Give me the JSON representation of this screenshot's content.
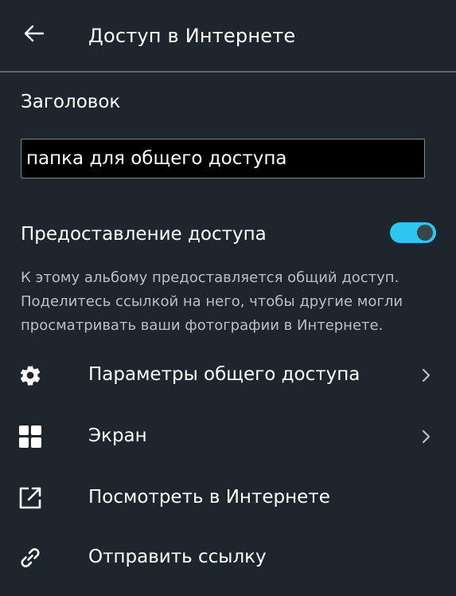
{
  "header": {
    "title": "Доступ в Интернете",
    "back_icon": "arrow-left-icon"
  },
  "title_section": {
    "label": "Заголовок",
    "input_value": "папка для общего доступа"
  },
  "sharing": {
    "label": "Предоставление доступа",
    "enabled": true,
    "description_lines": [
      "К этому альбому предоставляется общий доступ.",
      "Поделитесь ссылкой на него, чтобы другие могли",
      "просматривать ваши фотографии в Интернете."
    ],
    "toggle_color": "#2ec6f1"
  },
  "menu": {
    "items": [
      {
        "label": "Параметры общего доступа",
        "icon": "gear-icon",
        "has_chevron": true
      },
      {
        "label": "Экран",
        "icon": "layout-grid-icon",
        "has_chevron": true
      },
      {
        "label": "Посмотреть в Интернете",
        "icon": "open-external-icon",
        "has_chevron": false
      },
      {
        "label": "Отправить ссылку",
        "icon": "link-icon",
        "has_chevron": false
      }
    ]
  },
  "colors": {
    "background": "#1d262c",
    "divider": "#5f6a70",
    "accent": "#2ec6f1",
    "secondary_text": "#b9c0c4"
  }
}
